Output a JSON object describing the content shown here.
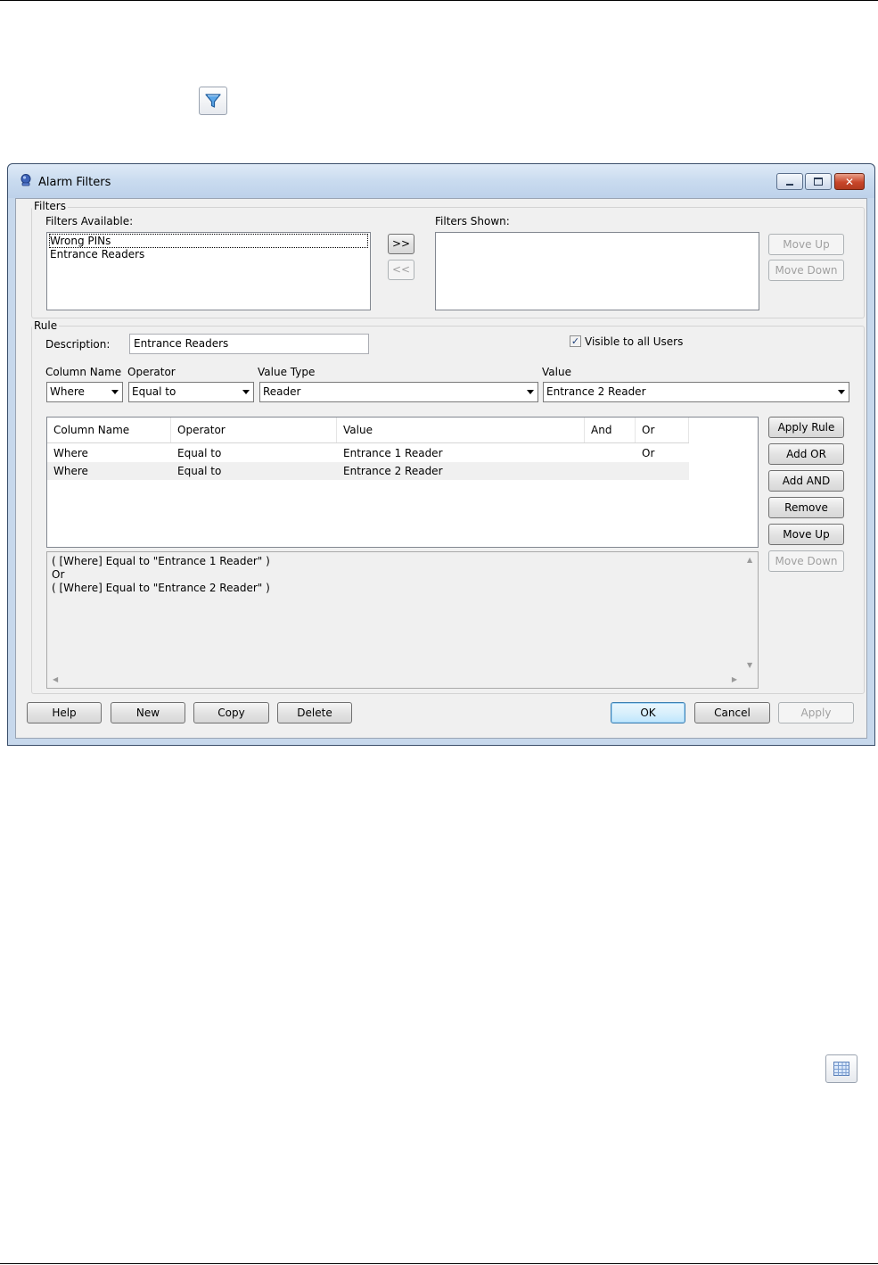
{
  "window": {
    "title": "Alarm Filters"
  },
  "filters": {
    "group_label": "Filters",
    "available_label": "Filters Available:",
    "available_items": [
      "Wrong PINs",
      "Entrance Readers"
    ],
    "shown_label": "Filters Shown:",
    "add_button": ">>",
    "remove_button": "<<",
    "move_up": "Move Up",
    "move_down": "Move Down"
  },
  "rule": {
    "group_label": "Rule",
    "description_label": "Description:",
    "description_value": "Entrance Readers",
    "visible_label": "Visible to all Users",
    "visible_checked": true,
    "column_name_label": "Column Name",
    "operator_label": "Operator",
    "value_type_label": "Value Type",
    "value_label": "Value",
    "column_name_value": "Where",
    "operator_value": "Equal to",
    "value_type_value": "Reader",
    "value_value": "Entrance 2 Reader",
    "table": {
      "columns": [
        "Column Name",
        "Operator",
        "Value",
        "And",
        "Or"
      ],
      "rows": [
        [
          "Where",
          "Equal to",
          "Entrance 1 Reader",
          "",
          "Or"
        ],
        [
          "Where",
          "Equal to",
          "Entrance 2 Reader",
          "",
          ""
        ]
      ]
    },
    "expression_lines": [
      "( [Where] Equal to \"Entrance 1 Reader\" )",
      "Or",
      "( [Where] Equal to \"Entrance 2 Reader\" )"
    ],
    "buttons": {
      "apply_rule": "Apply Rule",
      "add_or": "Add OR",
      "add_and": "Add AND",
      "remove": "Remove",
      "move_up": "Move Up",
      "move_down": "Move Down"
    }
  },
  "footer": {
    "help": "Help",
    "new": "New",
    "copy": "Copy",
    "delete": "Delete",
    "ok": "OK",
    "cancel": "Cancel",
    "apply": "Apply"
  },
  "icons": {
    "filter_icon": "filter-icon",
    "grid_icon": "grid-icon",
    "app_icon": "alarm-filters-app-icon"
  }
}
